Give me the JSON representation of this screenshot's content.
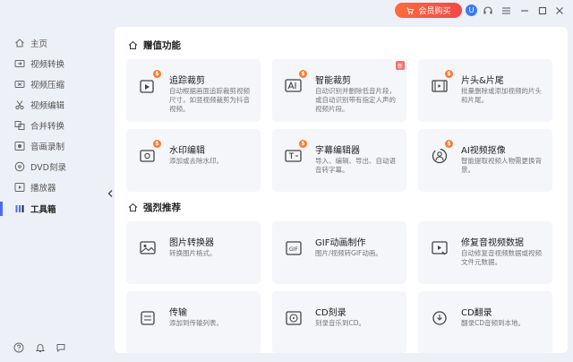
{
  "titlebar": {
    "vip_label": "会员购买",
    "avatar_text": "U"
  },
  "sidebar": {
    "items": [
      {
        "label": "主页",
        "icon": "home-icon"
      },
      {
        "label": "视频转换",
        "icon": "video-convert-icon"
      },
      {
        "label": "视频压缩",
        "icon": "video-compress-icon"
      },
      {
        "label": "视频编辑",
        "icon": "scissors-icon"
      },
      {
        "label": "合并转换",
        "icon": "merge-icon"
      },
      {
        "label": "音画录制",
        "icon": "record-icon"
      },
      {
        "label": "DVD刻录",
        "icon": "dvd-icon"
      },
      {
        "label": "播放器",
        "icon": "play-icon"
      },
      {
        "label": "工具箱",
        "icon": "toolbox-icon"
      }
    ],
    "active_index": 8
  },
  "sections": {
    "bonus_title": "赠值功能",
    "recommend_title": "强烈推荐"
  },
  "cards": {
    "tracking_crop": {
      "title": "追踪裁剪",
      "desc": "自动根据画面追踪裁剪视频尺寸，如竖视频裁剪为抖音视频。",
      "badge": "$"
    },
    "smart_crop": {
      "title": "智能裁剪",
      "desc": "自动识别并删除低音片段，或自动识别带有指定人声的视频片段。",
      "badge": "$",
      "tag": "新"
    },
    "intro_outro": {
      "title": "片头&片尾",
      "desc": "批量删除或添加视频的片头和片尾。",
      "badge": "$"
    },
    "watermark": {
      "title": "水印编辑",
      "desc": "添加或去除水印。",
      "badge": "$"
    },
    "subtitle": {
      "title": "字幕编辑器",
      "desc": "导入、编辑、导出、自动语音转字幕。",
      "badge": "$"
    },
    "ai_cutout": {
      "title": "AI视频抠像",
      "desc": "智能提取视频人物需更换背景。",
      "badge": "$"
    },
    "image_convert": {
      "title": "图片转换器",
      "desc": "转换图片格式。"
    },
    "gif_maker": {
      "title": "GIF动画制作",
      "desc": "图片/视频转GIF动画。"
    },
    "video_repair": {
      "title": "修复音视频数据",
      "desc": "自动修复音视频数据或视频文件元数据。"
    },
    "transfer": {
      "title": "传输",
      "desc": "添加到传输列表。"
    },
    "cd_burn": {
      "title": "CD刻录",
      "desc": "刻录音乐到CD。"
    },
    "cd_rip": {
      "title": "CD翻录",
      "desc": "翻录CD音频到本地。"
    }
  },
  "colors": {
    "accent": "#4b6bf5",
    "vip_start": "#ff6a3d",
    "vip_end": "#f04848",
    "badge": "#ff7a2e"
  }
}
